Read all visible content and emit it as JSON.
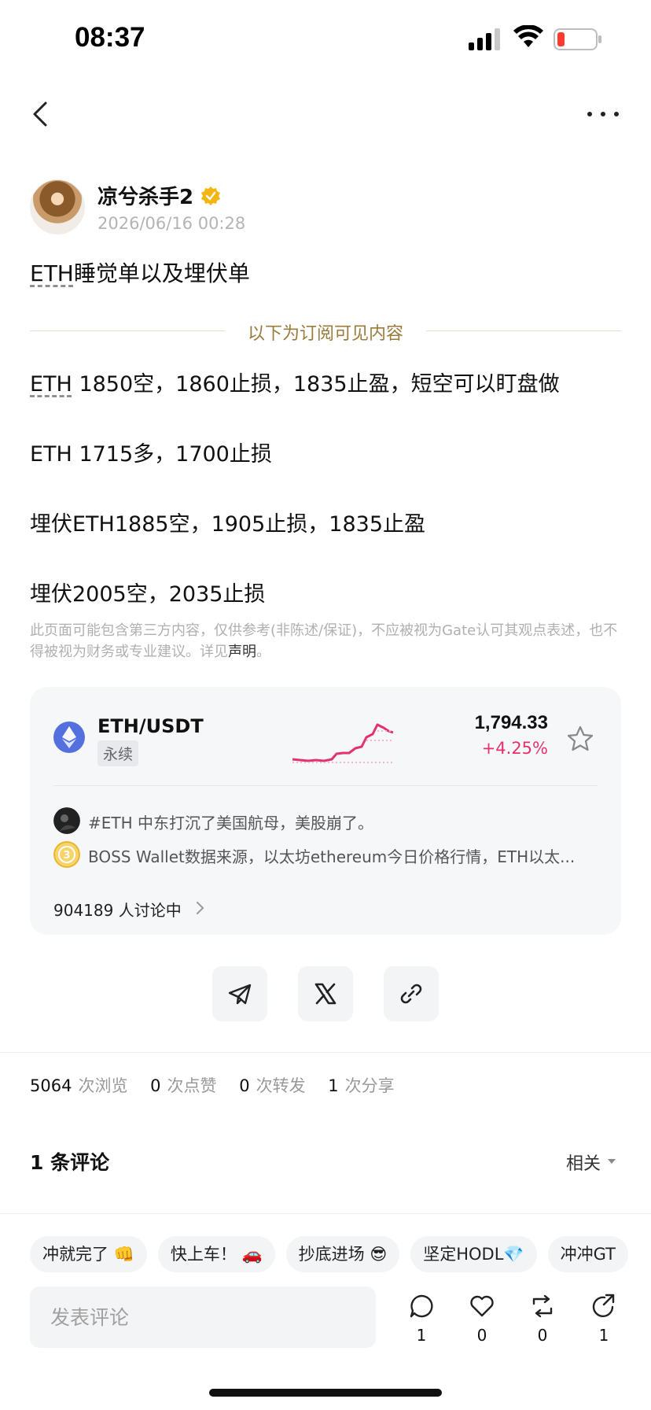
{
  "status_bar": {
    "time": "08:37"
  },
  "post": {
    "author": "凉兮杀手2",
    "timestamp": "2026/06/16 00:28",
    "title_tag": "ETH",
    "title_rest": "睡觉单以及埋伏单",
    "divider_text": "以下为订阅可见内容",
    "lines": [
      {
        "tag": "ETH",
        "text": " 1850空，1860止损，1835止盈，短空可以盯盘做"
      },
      {
        "tag": "",
        "text": "ETH 1715多，1700止损"
      },
      {
        "tag": "",
        "text": "埋伏ETH1885空，1905止损，1835止盈"
      },
      {
        "tag": "",
        "text": "埋伏2005空，2035止损"
      }
    ],
    "disclaimer": "此页面可能包含第三方内容，仅供参考(非陈述/保证)，不应被视为Gate认可其观点表述，也不得被视为财务或专业建议。详见",
    "disclaimer_link": "声明",
    "disclaimer_end": "。"
  },
  "market_card": {
    "pair": "ETH/USDT",
    "badge": "永续",
    "price": "1,794.33",
    "change": "+4.25%",
    "change_color": "#e4336b",
    "discussions": [
      {
        "text": "#ETH 中东打沉了美国航母，美股崩了。"
      },
      {
        "text": "BOSS Wallet数据来源，以太坊ethereum今日价格行情，ETH以太..."
      }
    ],
    "discuss_count": "904189 人讨论中"
  },
  "share": {
    "icons": [
      "telegram-icon",
      "x-icon",
      "link-icon"
    ]
  },
  "stats": {
    "views": "5064",
    "views_label": "次浏览",
    "likes": "0",
    "likes_label": "次点赞",
    "reposts": "0",
    "reposts_label": "次转发",
    "shares": "1",
    "shares_label": "次分享"
  },
  "comments": {
    "title": "1 条评论",
    "sort": "相关"
  },
  "bottom": {
    "chips": [
      "冲就完了 👊",
      "快上车！ 🚗",
      "抄底进场 😎",
      "坚定HODL💎",
      "冲冲GT"
    ],
    "input_placeholder": "发表评论",
    "actions": [
      {
        "icon": "comment-icon",
        "count": "1"
      },
      {
        "icon": "heart-icon",
        "count": "0"
      },
      {
        "icon": "repost-icon",
        "count": "0"
      },
      {
        "icon": "share-icon",
        "count": "1"
      }
    ]
  }
}
